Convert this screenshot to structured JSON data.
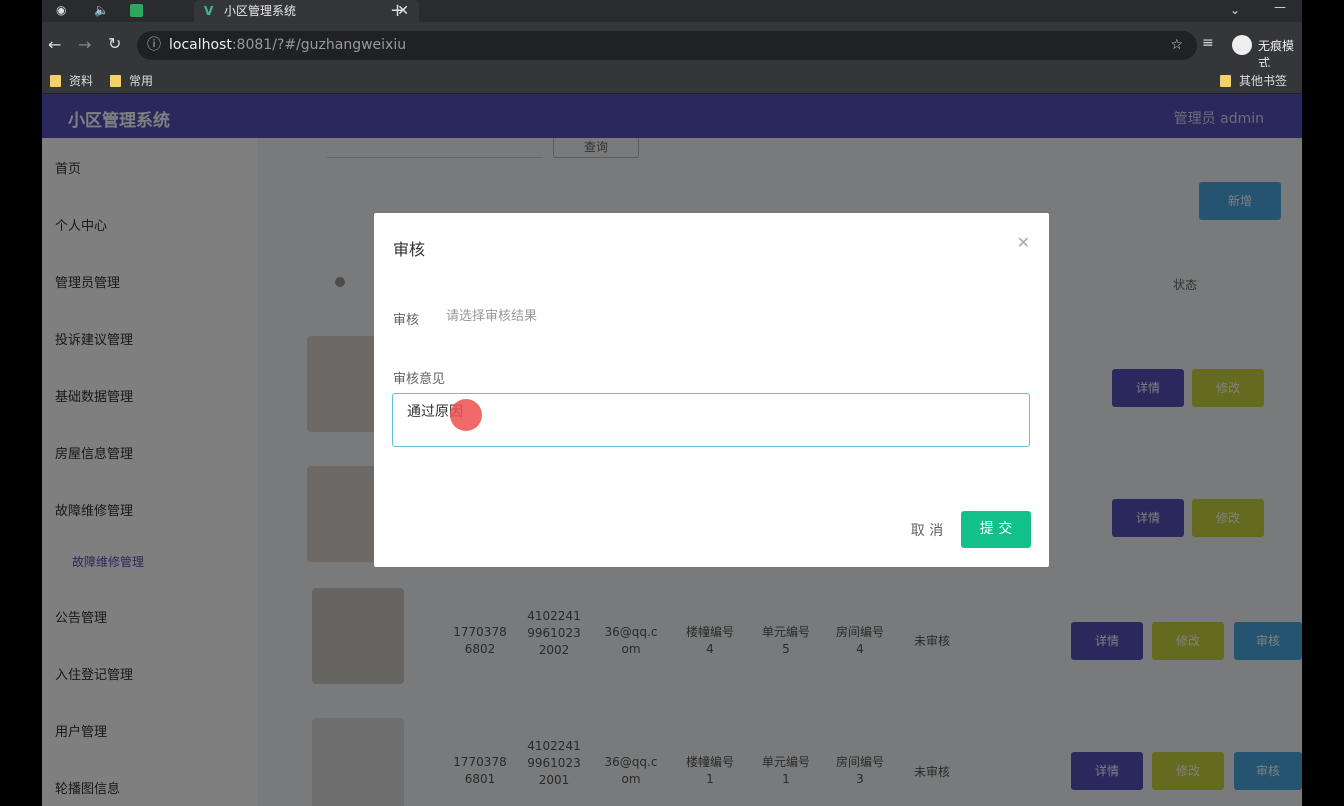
{
  "browser": {
    "tab_title": "小区管理系统",
    "url_host": "localhost",
    "url_rest": ":8081/?#/guzhangweixiu",
    "incognito_label": "无痕模式",
    "bookmarks": [
      "资料",
      "常用"
    ],
    "other_bookmarks": "其他书签"
  },
  "app": {
    "title": "小区管理系统",
    "user": "管理员 admin",
    "search_button": "查询",
    "add_button": "新增",
    "status_col": "状态"
  },
  "sidebar": {
    "items": [
      "首页",
      "个人中心",
      "管理员管理",
      "投诉建议管理",
      "基础数据管理",
      "房屋信息管理",
      "故障维修管理",
      "故障维修管理",
      "公告管理",
      "入住登记管理",
      "用户管理",
      "轮播图信息"
    ]
  },
  "table": {
    "rows": [
      {
        "phone": "1770378\n6802",
        "id": "4102241\n9961023\n2002",
        "email": "36@qq.c\nom",
        "building": "楼幢编号\n4",
        "unit": "单元编号\n5",
        "room": "房间编号\n4",
        "status": "未审核",
        "btn1": "详情",
        "btn2": "修改",
        "btn3": "审核"
      },
      {
        "phone": "1770378\n6801",
        "id": "4102241\n9961023\n2001",
        "email": "36@qq.c\nom",
        "building": "楼幢编号\n1",
        "unit": "单元编号\n1",
        "room": "房间编号\n3",
        "status": "未审核",
        "btn1": "详情",
        "btn2": "修改",
        "btn3": "审核"
      }
    ],
    "upper_btn1": "详情",
    "upper_btn2": "修改"
  },
  "dialog": {
    "title": "审核",
    "audit_label": "审核",
    "audit_placeholder": "请选择审核结果",
    "opinion_label": "审核意见",
    "opinion_value": "通过原因",
    "cancel": "取 消",
    "submit": "提 交"
  },
  "colors": {
    "header": "#5550b8",
    "primary": "#5550b8",
    "success": "#13c08a",
    "warning": "#c8d640",
    "info": "#4aa8e0"
  }
}
